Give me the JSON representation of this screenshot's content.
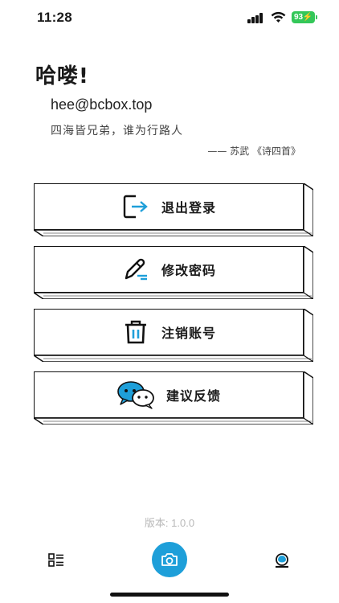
{
  "status_bar": {
    "time": "11:28",
    "battery": "93"
  },
  "header": {
    "greeting": "哈喽!",
    "email": "hee@bcbox.top",
    "quote": "四海皆兄弟，谁为行路人",
    "attribution": "—— 苏武 《诗四首》"
  },
  "menu": [
    {
      "label": "退出登录",
      "icon": "logout-icon"
    },
    {
      "label": "修改密码",
      "icon": "edit-password-icon"
    },
    {
      "label": "注销账号",
      "icon": "trash-icon"
    },
    {
      "label": "建议反馈",
      "icon": "chat-feedback-icon"
    }
  ],
  "version": "版本: 1.0.0",
  "tabbar": {
    "items": [
      {
        "icon": "list-icon"
      },
      {
        "icon": "camera-icon"
      },
      {
        "icon": "profile-icon"
      }
    ]
  },
  "colors": {
    "accent": "#1e9fd9",
    "battery": "#34c759"
  }
}
